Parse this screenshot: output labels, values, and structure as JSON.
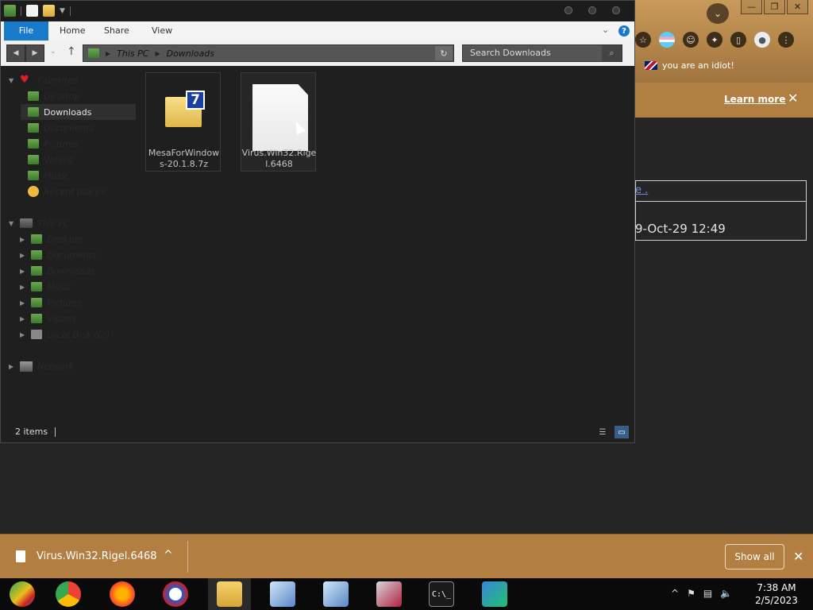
{
  "browser": {
    "win_controls": {
      "minimize": "—",
      "restore": "❐",
      "close": "✕"
    },
    "tab_menu_icon": "chevron-down-icon",
    "bookmark_label": "you are an idiot!",
    "infobar": {
      "learn_more": "Learn more",
      "close": "✕"
    },
    "page": {
      "link_text": "e .",
      "date_text": "9-Oct-29 12:49"
    },
    "accent": "#b27e42"
  },
  "download_shelf": {
    "filename": "Virus.Win32.Rigel.6468",
    "chevron": "^",
    "show_all": "Show all",
    "close": "✕"
  },
  "explorer": {
    "ribbon_tabs": {
      "file": "File",
      "home": "Home",
      "share": "Share",
      "view": "View"
    },
    "help": "?",
    "address": {
      "root": "This PC",
      "current": "Downloads"
    },
    "search_placeholder": "Search Downloads",
    "nav_tree": {
      "favorites": "Favorites",
      "fav_desktop": "Desktop",
      "fav_downloads": "Downloads",
      "fav_documents": "Documents",
      "fav_pictures": "Pictures",
      "fav_videos": "Videos",
      "fav_music": "Music",
      "fav_recent": "Recent places",
      "this_pc": "This PC",
      "pc_desktop": "Desktop",
      "pc_documents": "Documents",
      "pc_downloads": "Downloads",
      "pc_music": "Music",
      "pc_pictures": "Pictures",
      "pc_videos": "Videos",
      "pc_local_disk": "Local Disk (C:)",
      "network": "Network"
    },
    "files": [
      {
        "name": "MesaForWindows-20.1.8.7z",
        "icon": "7zip-archive-icon"
      },
      {
        "name": "Virus.Win32.Rigel.6468",
        "icon": "blank-file-icon"
      }
    ],
    "status": "2 items",
    "accent": "#1979ca"
  },
  "taskbar": {
    "cmd_label": "C:\\_",
    "time": "7:38 AM",
    "date": "2/5/2023"
  }
}
